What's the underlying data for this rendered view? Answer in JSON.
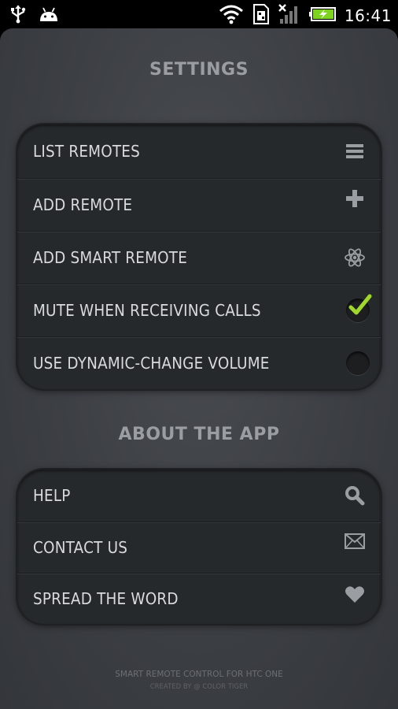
{
  "status_bar": {
    "time": "16:41",
    "icons": [
      "usb-icon",
      "android-icon",
      "wifi-icon",
      "sim-card-icon",
      "signal-icon",
      "battery-charging-icon"
    ]
  },
  "settings": {
    "title": "SETTINGS",
    "items": [
      {
        "label": "LIST REMOTES",
        "icon": "list-icon"
      },
      {
        "label": "ADD REMOTE",
        "icon": "plus-icon"
      },
      {
        "label": "ADD SMART REMOTE",
        "icon": "atom-icon"
      },
      {
        "label": "MUTE WHEN RECEIVING CALLS",
        "icon": "checkbox-checked",
        "checked": true
      },
      {
        "label": "USE DYNAMIC-CHANGE VOLUME",
        "icon": "checkbox-unchecked",
        "checked": false
      }
    ]
  },
  "about": {
    "title": "ABOUT THE APP",
    "items": [
      {
        "label": "HELP",
        "icon": "search-icon"
      },
      {
        "label": "CONTACT US",
        "icon": "envelope-icon"
      },
      {
        "label": "SPREAD THE WORD",
        "icon": "heart-icon"
      }
    ]
  },
  "footer": {
    "line1": "SMART REMOTE CONTROL FOR HTC ONE",
    "line2": "CREATED BY @ COLOR TIGER"
  },
  "colors": {
    "accent_check": "#9fd72a",
    "background": "#3c3f44",
    "panel": "#26292c",
    "text": "#d8dadc",
    "section_title": "#9a9da1"
  }
}
